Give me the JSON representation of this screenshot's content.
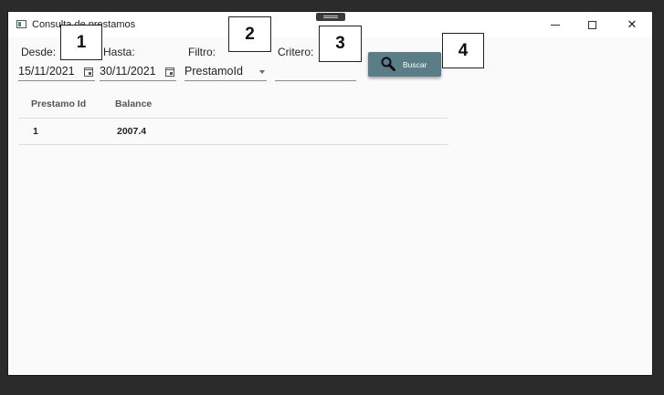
{
  "window": {
    "title": "Consulta de prestamos"
  },
  "form": {
    "desde_label": "Desde:",
    "desde_value": "15/11/2021",
    "hasta_label": "Hasta:",
    "hasta_value": "30/11/2021",
    "filtro_label": "Filtro:",
    "filtro_value": "PrestamoId",
    "criterio_label": "Critero:",
    "criterio_value": "",
    "buscar_label": "Buscar"
  },
  "callouts": [
    "1",
    "2",
    "3",
    "4"
  ],
  "table": {
    "columns": [
      "Prestamo Id",
      "Balance"
    ],
    "rows": [
      {
        "prestamo_id": "1",
        "balance": "2007.4"
      }
    ]
  },
  "colors": {
    "button": "#5b7d87",
    "background": "#fafafa",
    "desktop": "#2b2b2b"
  }
}
